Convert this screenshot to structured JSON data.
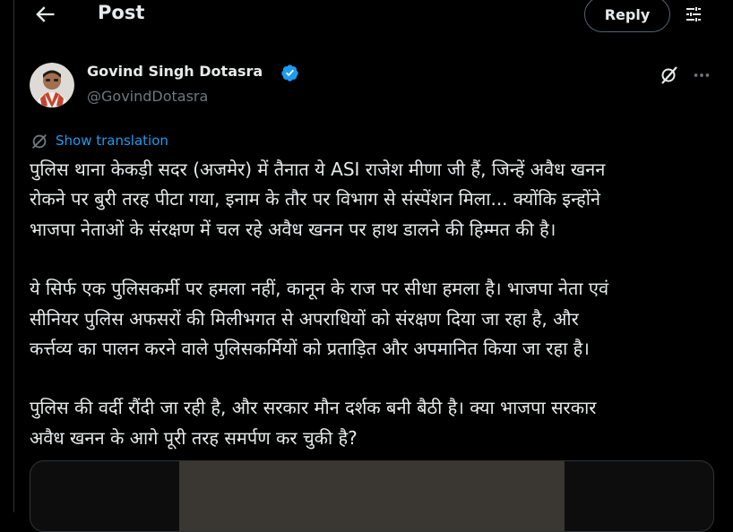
{
  "header": {
    "title": "Post",
    "reply_label": "Reply"
  },
  "author": {
    "name": "Govind Singh Dotasra",
    "handle": "@GovindDotasra"
  },
  "translation": {
    "label": "Show translation"
  },
  "post": {
    "lines": [
      "पुलिस थाना केकड़ी सदर (अजमेर) में तैनात ये ASI राजेश मीणा जी हैं, जिन्हें अवैध खनन",
      "रोकने पर बुरी तरह पीटा गया, इनाम के तौर पर विभाग से संस्पेंशन मिला... क्योंकि इन्होंने",
      "भाजपा नेताओं के संरक्षण में चल रहे अवैध खनन पर हाथ डालने की हिम्मत की है।",
      "",
      "ये सिर्फ एक पुलिसकर्मी पर हमला नहीं, कानून के राज पर सीधा हमला है। भाजपा नेता एवं",
      "सीनियर पुलिस अफसरों की मिलीभगत से अपराधियों को संरक्षण दिया जा रहा है, और",
      "कर्त्तव्य का पालन करने वाले पुलिसकर्मियों को प्रताड़ित और अपमानित किया जा रहा है।",
      "",
      "पुलिस की वर्दी रौंदी जा रही है, और सरकार मौन दर्शक बनी बैठी है। क्या भाजपा सरकार",
      "अवैध खनन के आगे पूरी तरह समर्पण कर चुकी है?"
    ]
  },
  "icons": {
    "back": "arrow-left-icon",
    "tune": "tune-icon",
    "verified": "verified-badge-icon",
    "grok": "grok-icon",
    "more": "more-icon",
    "translate": "translate-icon"
  },
  "colors": {
    "background": "#000000",
    "text": "#e7e9ea",
    "secondary": "#71767b",
    "accent": "#1d9bf0",
    "border": "#2f3336"
  }
}
